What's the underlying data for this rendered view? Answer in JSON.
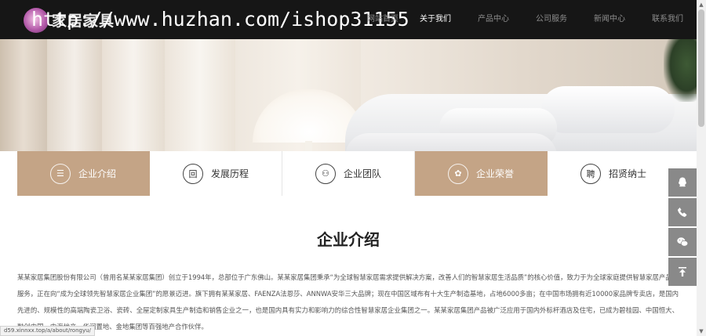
{
  "header": {
    "logo_text": "家居家具",
    "watermark": "http://www.huzhan.com/ishop31155",
    "nav": [
      {
        "label": "网站首页"
      },
      {
        "label": "关于我们"
      },
      {
        "label": "产品中心"
      },
      {
        "label": "公司服务"
      },
      {
        "label": "新闻中心"
      },
      {
        "label": "联系我们"
      }
    ]
  },
  "tabs": [
    {
      "label": "企业介绍",
      "icon": "document-icon",
      "glyph": "☰"
    },
    {
      "label": "发展历程",
      "icon": "history-icon",
      "glyph": "回"
    },
    {
      "label": "企业团队",
      "icon": "team-icon",
      "glyph": "⚇"
    },
    {
      "label": "企业荣誉",
      "icon": "honor-icon",
      "glyph": "✿"
    },
    {
      "label": "招贤纳士",
      "icon": "recruit-icon",
      "glyph": "聘"
    }
  ],
  "content": {
    "title": "企业介绍",
    "paragraph": "某某家居集团股份有限公司（曾用名某某家居集团）创立于1994年，总部位于广东佛山。某某家居集团秉承“为全球智慧家居需求提供解决方案，改善人们的智慧家居生活品质”的核心价值，致力于为全球家庭提供智慧家居产品与服务，正在向“成为全球领先智慧家居企业集团”的愿景迈进。旗下拥有某某家居、FAENZA法恩莎、ANNWA安华三大品牌；现在中国区域布有十大生产制造基地，占地6000多亩；在中国市场拥有近10000家品牌专卖店，是国内先进的、规模性的高端陶瓷卫浴、瓷砖、全屋定制家具生产制造和销售企业之一，也是国内具有实力和影响力的综合性智慧家居企业集团之一。某某家居集团产品被广泛应用于国内外标杆酒店及住宅，已成为碧桂园、中国恒大、融创中国、中海地产、华润置地、金地集团等百强地产合作伙伴。"
  },
  "status_bar": {
    "url": "d59.xinnxx.top/a/about/rongyu/"
  },
  "colors": {
    "header_bg": "#161616",
    "accent": "#c4a486",
    "side_button": "#898989"
  },
  "side_tools": [
    "qq-icon",
    "phone-icon",
    "wechat-icon",
    "back-to-top-icon"
  ]
}
